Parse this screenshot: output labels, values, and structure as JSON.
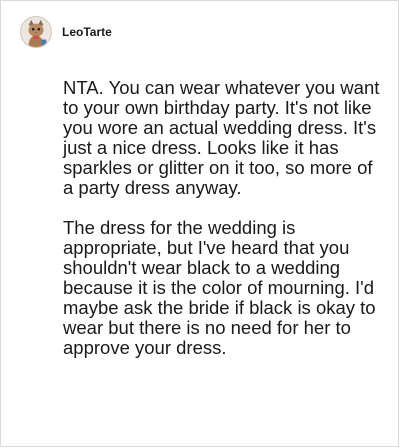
{
  "post": {
    "author": {
      "username": "LeoTarte",
      "avatar_icon": "cat-avatar-icon"
    },
    "paragraphs": [
      "NTA. You can wear whatever you want to your own birthday party. It's not like you wore an actual wedding dress. It's just a nice dress. Looks like it has sparkles or glitter on it too, so more of a party dress anyway.",
      "The dress for the wedding is appropriate, but I've heard that you shouldn't wear black to a wedding because it is the color of mourning. I'd maybe ask the bride if black is okay to wear but there is no need for her to approve your dress."
    ]
  }
}
